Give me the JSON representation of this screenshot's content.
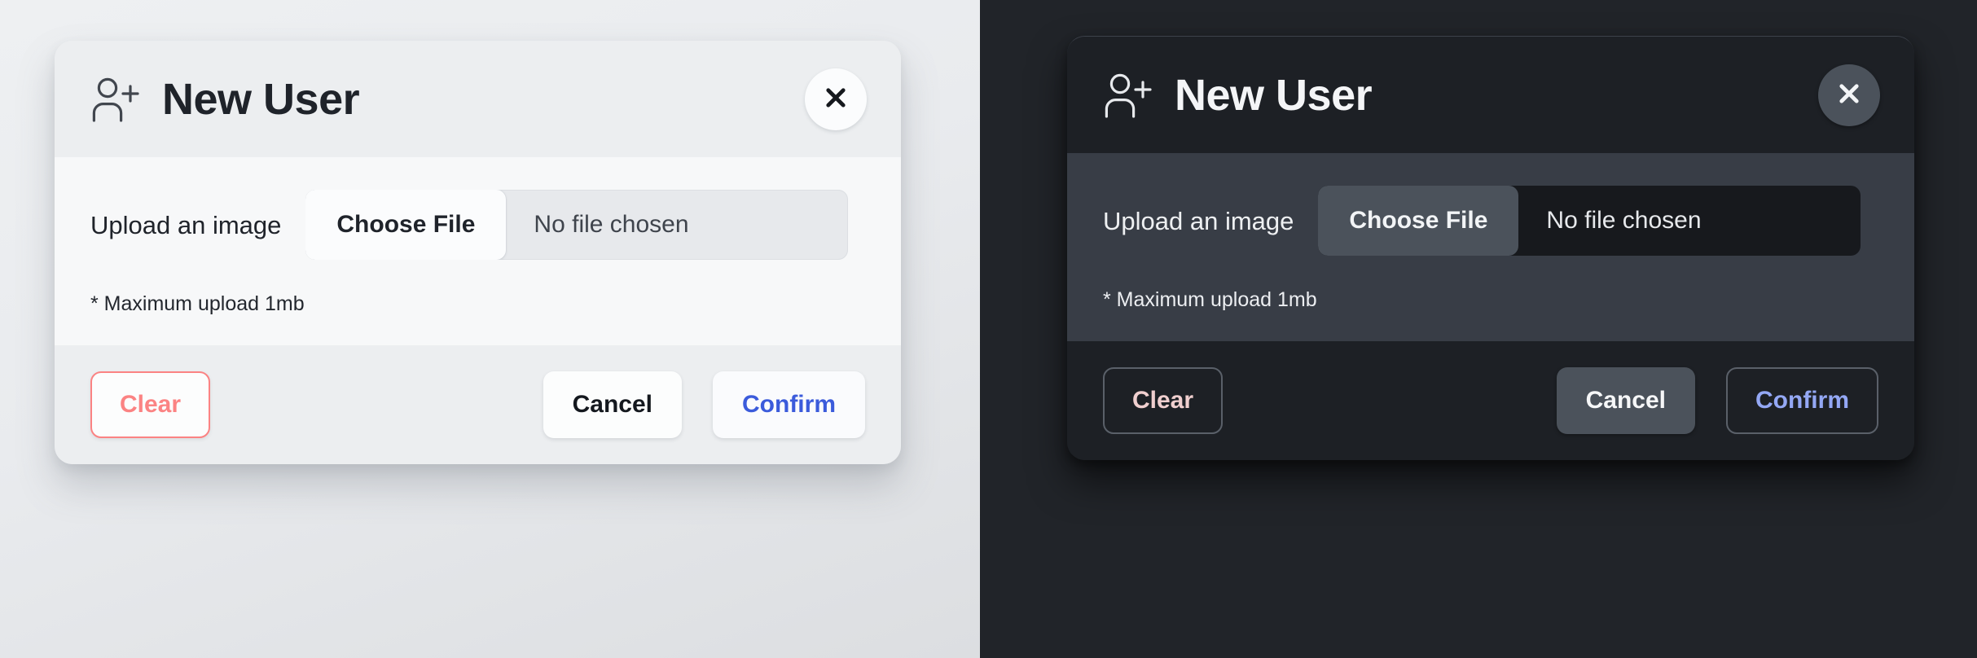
{
  "theme_light": {
    "name": "light",
    "header": {
      "icon": "user-plus-icon",
      "title": "New User",
      "close_icon": "close-icon"
    },
    "body": {
      "upload_label": "Upload an image",
      "choose_file_label": "Choose File",
      "file_status": "No file chosen",
      "hint": "* Maximum upload 1mb"
    },
    "footer": {
      "clear_label": "Clear",
      "cancel_label": "Cancel",
      "confirm_label": "Confirm"
    },
    "colors": {
      "panel_header": "#eceef0",
      "panel_body": "#f7f8f9",
      "backdrop": "#e9ebee",
      "title_text": "#1f232a",
      "clear_accent": "#fb8383",
      "confirm_accent": "#3b5bdb",
      "cancel_text": "#14181e"
    }
  },
  "theme_dark": {
    "name": "dark",
    "header": {
      "icon": "user-plus-icon",
      "title": "New User",
      "close_icon": "close-icon"
    },
    "body": {
      "upload_label": "Upload an image",
      "choose_file_label": "Choose File",
      "file_status": "No file chosen",
      "hint": "* Maximum upload 1mb"
    },
    "footer": {
      "clear_label": "Clear",
      "cancel_label": "Cancel",
      "confirm_label": "Confirm"
    },
    "colors": {
      "panel_header": "#1d2025",
      "panel_body": "#383d46",
      "backdrop": "#212429",
      "title_text": "#f4f5f7",
      "clear_accent": "#f0cfcf",
      "confirm_accent": "#94a8f5",
      "cancel_bg": "#4b525b",
      "close_bg": "#4b525b",
      "choose_file_bg": "#4b525b",
      "file_field_bg": "#17191d"
    }
  }
}
